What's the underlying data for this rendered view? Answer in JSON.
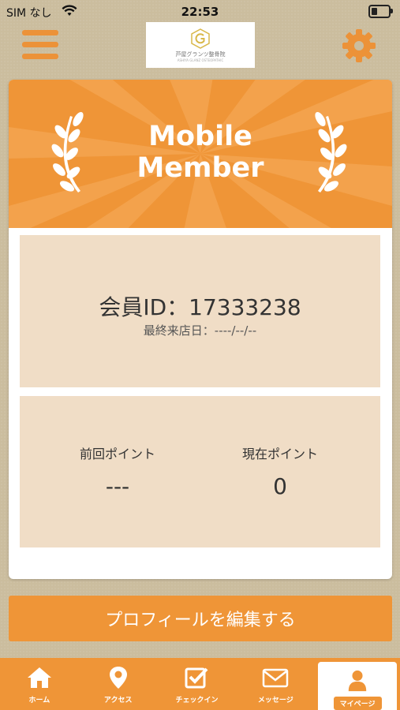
{
  "status_bar": {
    "carrier": "SIM なし",
    "time": "22:53"
  },
  "header": {
    "logo_text": "芦屋グランツ整骨院",
    "logo_subtext": "ASHIYA GLANZ OSTEOPATHIC"
  },
  "banner": {
    "line1": "Mobile",
    "line2": "Member"
  },
  "member": {
    "id_label": "会員ID：17333238",
    "last_visit": "最終来店日：----/--/--"
  },
  "points": {
    "previous_label": "前回ポイント",
    "previous_value": "---",
    "current_label": "現在ポイント",
    "current_value": "0"
  },
  "edit_profile_button": "プロフィールを編集する",
  "tabs": [
    {
      "label": "ホーム",
      "icon": "home-icon"
    },
    {
      "label": "アクセス",
      "icon": "map-pin-icon"
    },
    {
      "label": "チェックイン",
      "icon": "checkbox-icon"
    },
    {
      "label": "メッセージ",
      "icon": "envelope-icon"
    },
    {
      "label": "マイページ",
      "icon": "person-icon",
      "active": true
    }
  ],
  "colors": {
    "accent": "#ef9537",
    "panel": "#f0ddc6",
    "background": "#cbbd9e"
  }
}
